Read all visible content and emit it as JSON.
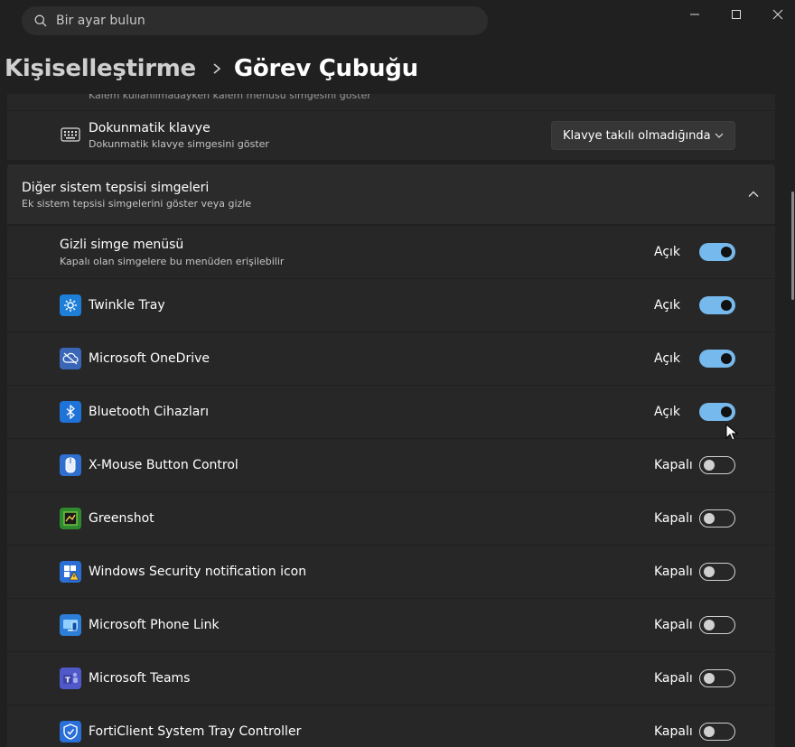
{
  "search": {
    "placeholder": "Bir ayar bulun"
  },
  "breadcrumb": {
    "parent": "Kişiselleştirme",
    "current": "Görev Çubuğu"
  },
  "partial_row": {
    "subtitle": "Kalem kullanılmadayken kalem menüsü simgesini göster"
  },
  "touch_keyboard": {
    "title": "Dokunmatik klavye",
    "subtitle": "Dokunmatik klavye simgesini göster",
    "dropdown_value": "Klavye takılı olmadığında"
  },
  "other_tray_icons": {
    "title": "Diğer sistem tepsisi simgeleri",
    "subtitle": "Ek sistem tepsisi simgelerini göster veya gizle",
    "expanded": true
  },
  "hidden_menu": {
    "title": "Gizli simge menüsü",
    "subtitle": "Kapalı olan simgelere bu menüden erişilebilir",
    "state_label": "Açık",
    "on": true
  },
  "apps": [
    {
      "name": "Twinkle Tray",
      "state_label": "Açık",
      "on": true,
      "icon": "twinkle-tray-icon",
      "color": "#1e7fd8"
    },
    {
      "name": "Microsoft OneDrive",
      "state_label": "Açık",
      "on": true,
      "icon": "onedrive-icon",
      "color": "#3a66b8"
    },
    {
      "name": "Bluetooth Cihazları",
      "state_label": "Açık",
      "on": true,
      "icon": "bluetooth-icon",
      "color": "#1e72d8"
    },
    {
      "name": "X-Mouse Button Control",
      "state_label": "Kapalı",
      "on": false,
      "icon": "xmouse-icon",
      "color": "#2f6fd0"
    },
    {
      "name": "Greenshot",
      "state_label": "Kapalı",
      "on": false,
      "icon": "greenshot-icon",
      "color": "#2d8a2d"
    },
    {
      "name": "Windows Security notification icon",
      "state_label": "Kapalı",
      "on": false,
      "icon": "windows-security-icon",
      "color": "#2b6fd6"
    },
    {
      "name": "Microsoft Phone Link",
      "state_label": "Kapalı",
      "on": false,
      "icon": "phone-link-icon",
      "color": "#2d7ed8"
    },
    {
      "name": "Microsoft Teams",
      "state_label": "Kapalı",
      "on": false,
      "icon": "teams-icon",
      "color": "#5059c9"
    },
    {
      "name": "FortiClient System Tray Controller",
      "state_label": "Kapalı",
      "on": false,
      "icon": "forticlient-icon",
      "color": "#2a6fd8"
    }
  ],
  "accent_color": "#76b9ed"
}
